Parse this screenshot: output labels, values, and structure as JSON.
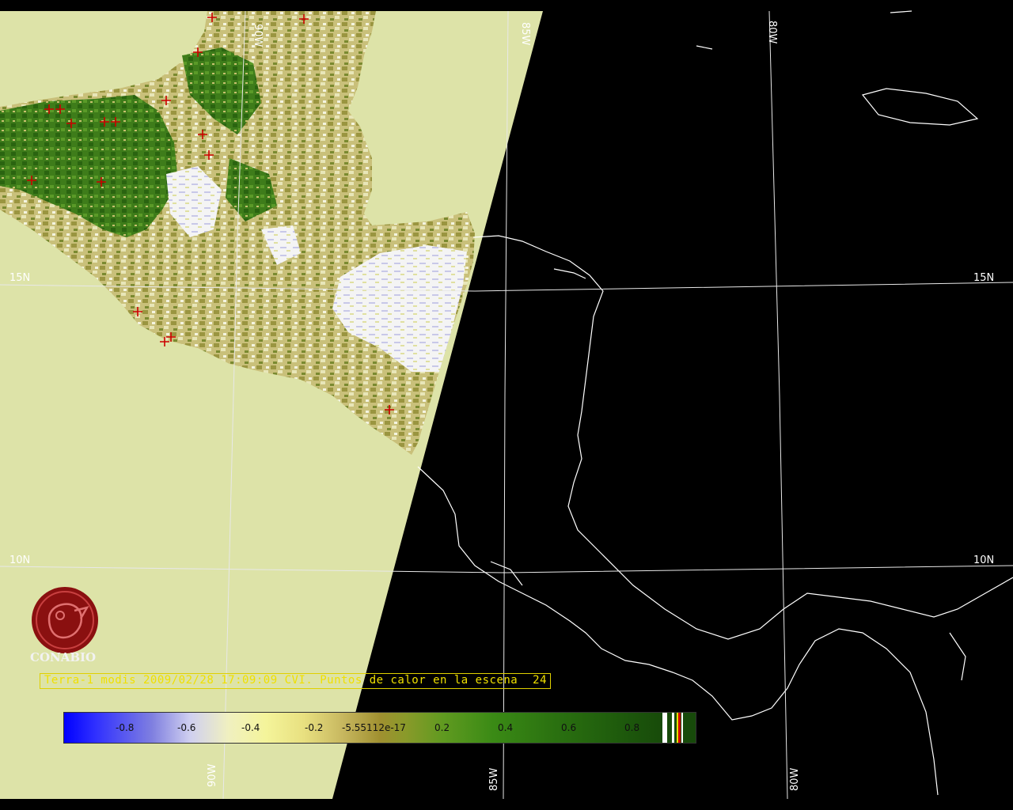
{
  "gridlabels": {
    "lat_15n_left": "15N",
    "lat_15n_right": "15N",
    "lat_10n_left": "10N",
    "lat_10n_right": "10N",
    "lon_90w_top": "90W",
    "lon_85w_top": "85W",
    "lon_80w_top": "80W",
    "lon_90w_bottom": "90W",
    "lon_85w_bottom": "85W",
    "lon_80w_bottom": "80W"
  },
  "caption": {
    "text": "Terra-1 modis 2009/02/28 17:09:09 CVI. Puntos de calor en la escena",
    "count": "24"
  },
  "colorbar": {
    "ticks": [
      "-0.8",
      "-0.6",
      "-0.4",
      "-0.2",
      "-5.55112e-17",
      "0.2",
      "0.4",
      "0.6",
      "0.8"
    ]
  },
  "logo": {
    "name": "CONABIO"
  },
  "colors": {
    "land_background": "#dde3a8",
    "night_side": "#000000",
    "hotspot": "#cc0000",
    "caption": "#f0e000"
  }
}
